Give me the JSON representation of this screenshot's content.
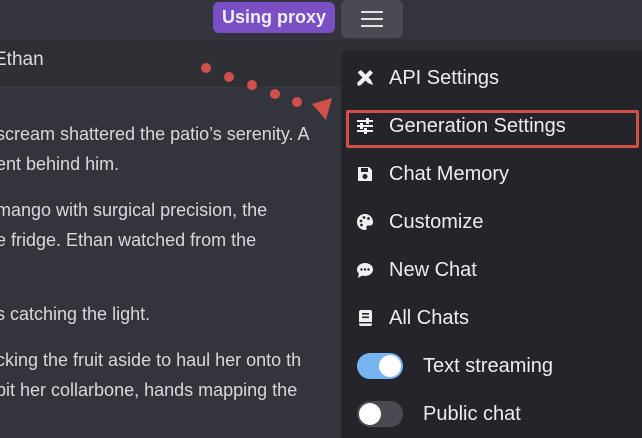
{
  "header": {
    "proxy_badge": "Using proxy",
    "menu_icon": "hamburger-icon"
  },
  "chat": {
    "character_name": "Ethan",
    "lines": [
      "scream shattered the patio’s serenity. A",
      "ent behind him.",
      "mango with surgical precision, the",
      "e fridge. Ethan watched from the",
      "s catching the light.",
      "cking the fruit aside to haul her onto th",
      "bit her collarbone, hands mapping the"
    ]
  },
  "menu": {
    "items": [
      {
        "label": "API Settings",
        "icon": "tools-icon"
      },
      {
        "label": "Generation Settings",
        "icon": "sliders-icon"
      },
      {
        "label": "Chat Memory",
        "icon": "save-icon"
      },
      {
        "label": "Customize",
        "icon": "palette-icon"
      },
      {
        "label": "New Chat",
        "icon": "chat-bubble-icon"
      },
      {
        "label": "All Chats",
        "icon": "book-icon"
      }
    ],
    "toggles": [
      {
        "label": "Text streaming",
        "state": "on"
      },
      {
        "label": "Public chat",
        "state": "off"
      }
    ]
  },
  "colors": {
    "accent": "#7a4fc4",
    "highlight": "#d2504a",
    "toggle_on": "#76b5ef"
  }
}
